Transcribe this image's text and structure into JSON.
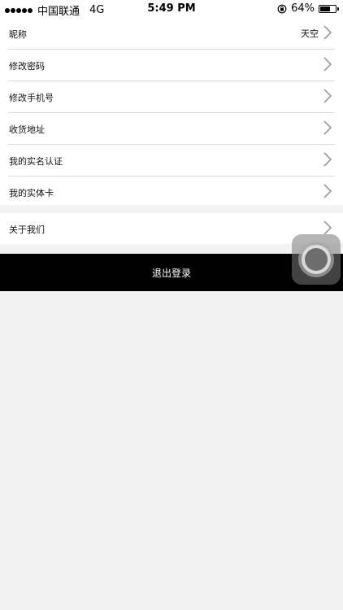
{
  "status_bar": {
    "carrier": "中国联通",
    "network": "4G",
    "time": "5:49 PM",
    "battery_percent": "64%",
    "battery_level": 0.64
  },
  "menu": {
    "nickname_label": "昵称",
    "nickname_value": "天空",
    "change_password": "修改密码",
    "change_phone": "修改手机号",
    "shipping_address": "收货地址",
    "real_name_auth": "我的实名认证",
    "physical_card": "我的实体卡",
    "about_us": "关于我们"
  },
  "logout_label": "退出登录",
  "colors": {
    "background": "#f3f3f3",
    "logout_bg": "#000000",
    "logout_text": "#ffffff",
    "chevron": "#9a9a9a"
  },
  "icons": [
    "signal-dots-icon",
    "rotation-lock-icon",
    "battery-icon",
    "chevron-right-icon",
    "assistive-touch-icon"
  ]
}
